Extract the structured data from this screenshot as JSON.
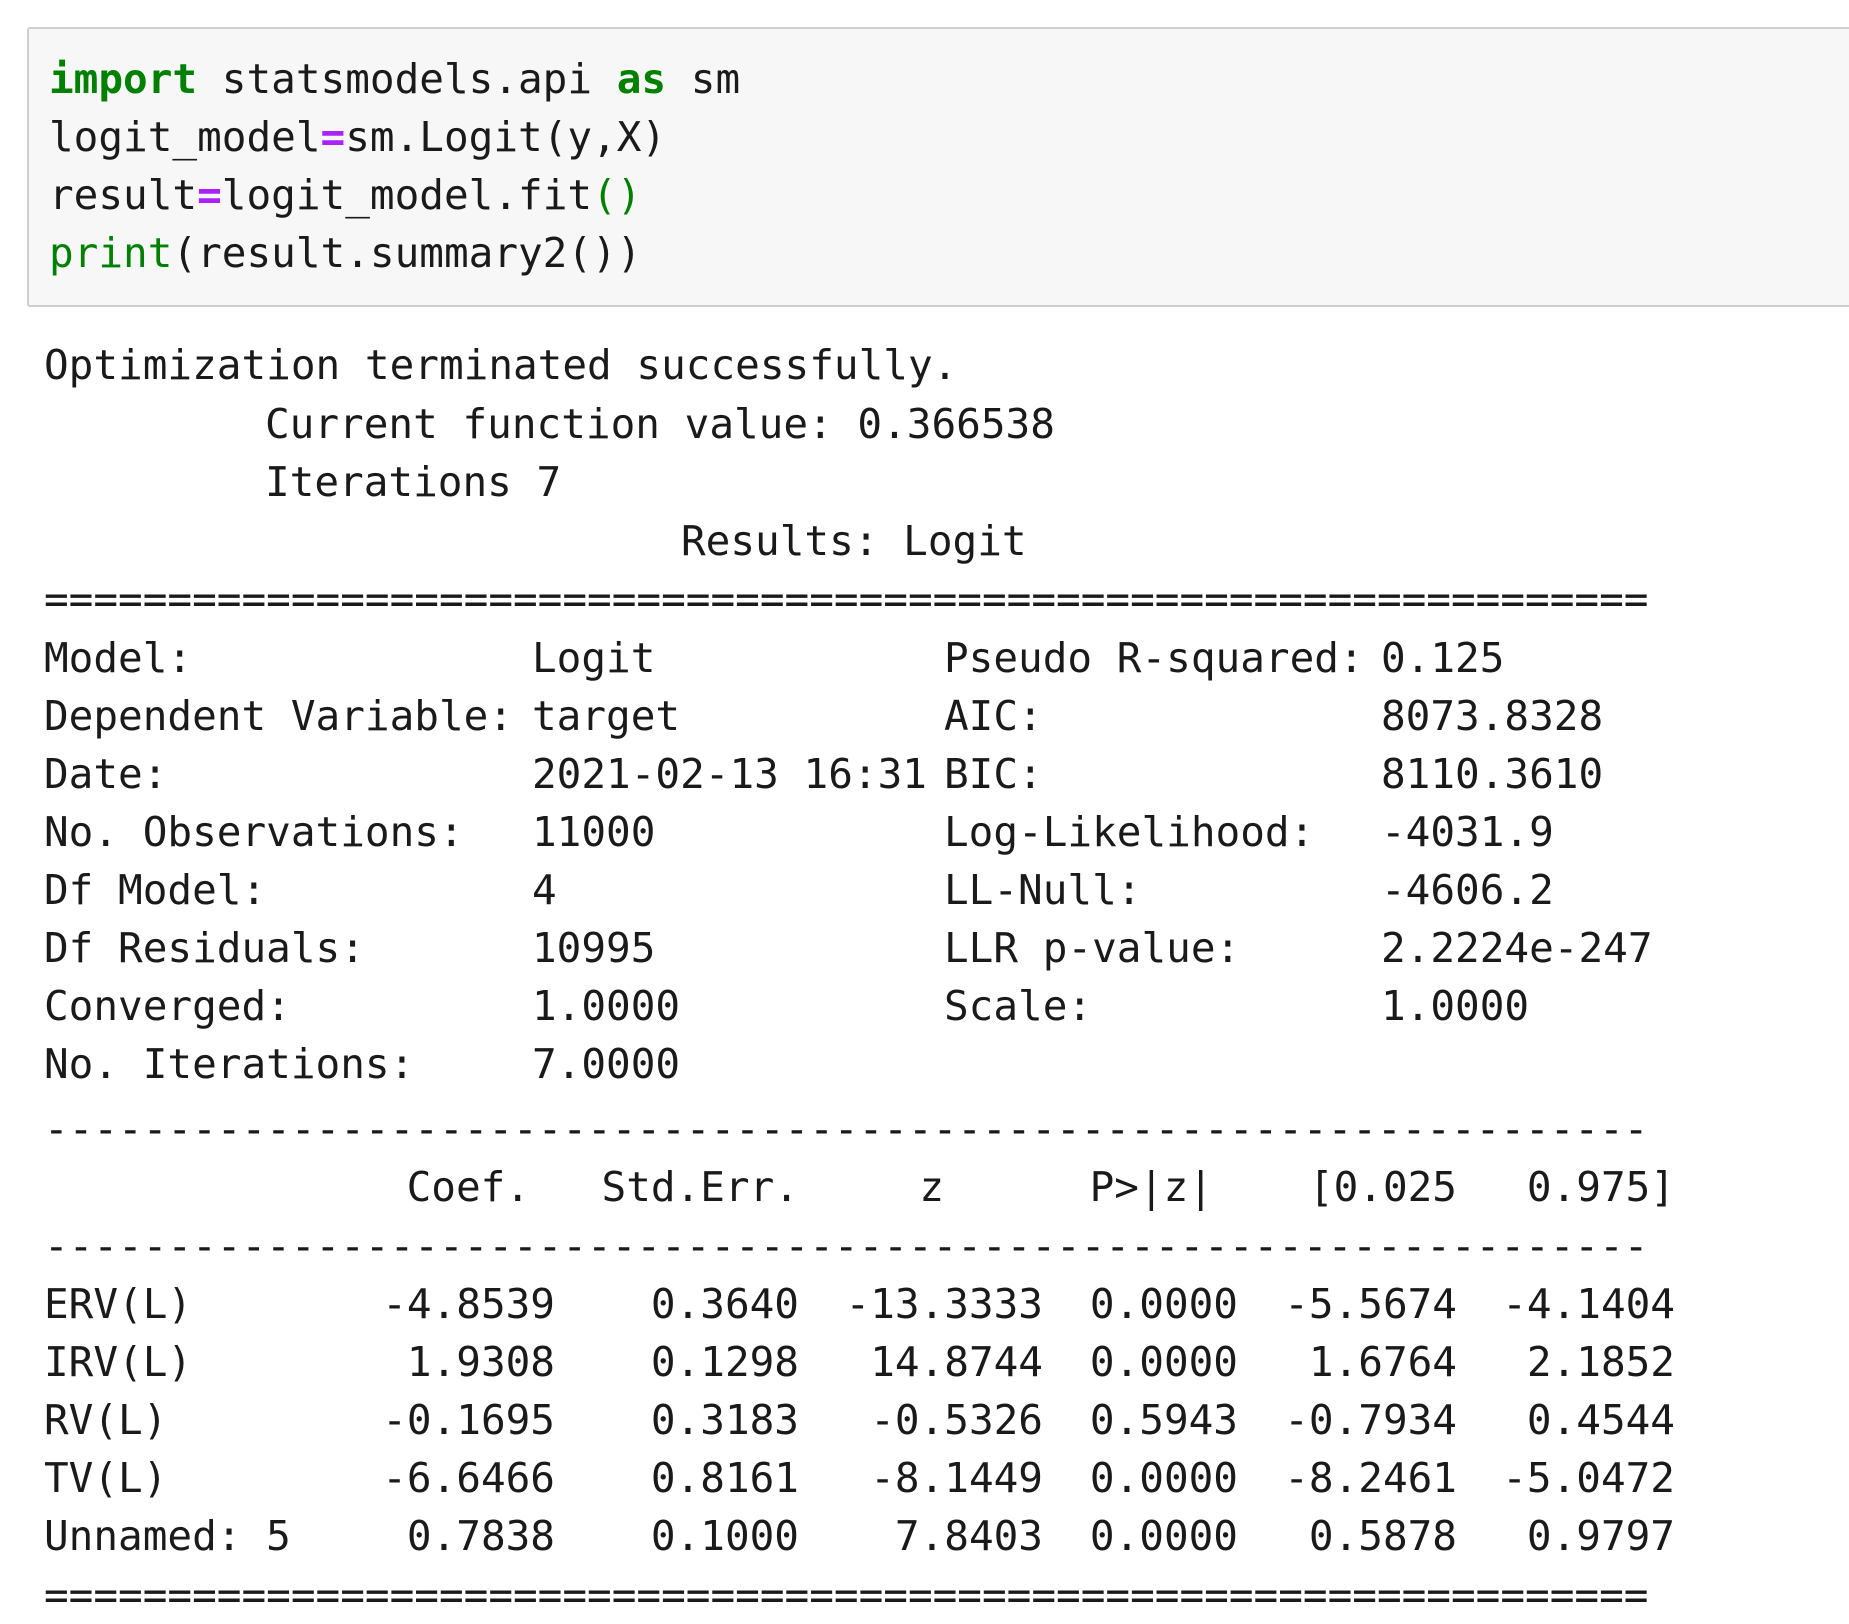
{
  "input_cell": {
    "lines": [
      [
        {
          "t": "import",
          "c": "kw"
        },
        {
          "t": " statsmodels.api ",
          "c": ""
        },
        {
          "t": "as",
          "c": "kw"
        },
        {
          "t": " sm",
          "c": ""
        }
      ],
      [
        {
          "t": "logit_model",
          "c": ""
        },
        {
          "t": "=",
          "c": "op"
        },
        {
          "t": "sm.Logit(y,X)",
          "c": ""
        }
      ],
      [
        {
          "t": "result",
          "c": ""
        },
        {
          "t": "=",
          "c": "op"
        },
        {
          "t": "logit_model.fit",
          "c": ""
        },
        {
          "t": "()",
          "c": "paren-g"
        }
      ],
      [
        {
          "t": "print",
          "c": "builtin"
        },
        {
          "t": "(result.summary2())",
          "c": ""
        }
      ]
    ]
  },
  "output": {
    "optimization": "Optimization terminated successfully.",
    "function_value": "Current function value: 0.366538",
    "iterations": "Iterations 7",
    "results_title": "Results: Logit",
    "double_rule": "=================================================================",
    "single_rule": "-----------------------------------------------------------------",
    "info_left": [
      {
        "label": "Model:",
        "value": "Logit"
      },
      {
        "label": "Dependent Variable:",
        "value": "target"
      },
      {
        "label": "Date:",
        "value": "2021-02-13 16:31"
      },
      {
        "label": "No. Observations:",
        "value": "11000"
      },
      {
        "label": "Df Model:",
        "value": "4"
      },
      {
        "label": "Df Residuals:",
        "value": "10995"
      },
      {
        "label": "Converged:",
        "value": "1.0000"
      },
      {
        "label": "No. Iterations:",
        "value": "7.0000"
      }
    ],
    "info_right": [
      {
        "label": "Pseudo R-squared:",
        "value": "0.125"
      },
      {
        "label": "AIC:",
        "value": "8073.8328"
      },
      {
        "label": "BIC:",
        "value": "8110.3610"
      },
      {
        "label": "Log-Likelihood:",
        "value": "-4031.9"
      },
      {
        "label": "LL-Null:",
        "value": "-4606.2"
      },
      {
        "label": "LLR p-value:",
        "value": "2.2224e-247"
      },
      {
        "label": "Scale:",
        "value": "1.0000"
      }
    ],
    "coef_headers": [
      "Coef.",
      "Std.Err.",
      "z",
      "P>|z|",
      "[0.025",
      "0.975]"
    ],
    "coef_rows": [
      {
        "name": "ERV(L)",
        "values": [
          "-4.8539",
          "0.3640",
          "-13.3333",
          "0.0000",
          "-5.5674",
          "-4.1404"
        ]
      },
      {
        "name": "IRV(L)",
        "values": [
          "1.9308",
          "0.1298",
          "14.8744",
          "0.0000",
          "1.6764",
          "2.1852"
        ]
      },
      {
        "name": "RV(L)",
        "values": [
          "-0.1695",
          "0.3183",
          "-0.5326",
          "0.5943",
          "-0.7934",
          "0.4544"
        ]
      },
      {
        "name": "TV(L)",
        "values": [
          "-6.6466",
          "0.8161",
          "-8.1449",
          "0.0000",
          "-8.2461",
          "-5.0472"
        ]
      },
      {
        "name": "Unnamed: 5",
        "values": [
          "0.7838",
          "0.1000",
          "7.8403",
          "0.0000",
          "0.5878",
          "0.9797"
        ]
      }
    ]
  }
}
